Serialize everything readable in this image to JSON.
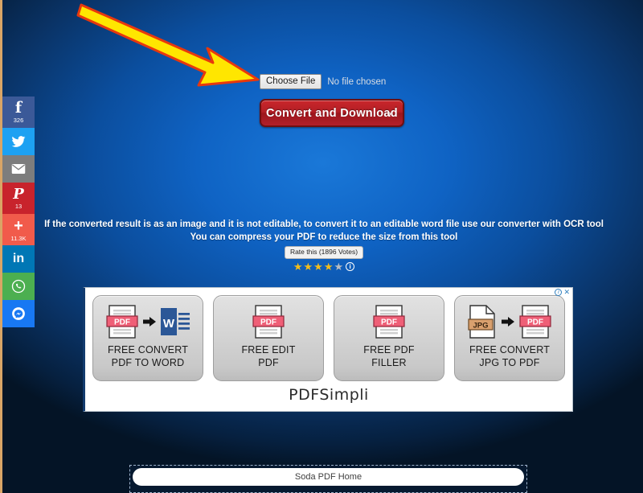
{
  "theme": {
    "background_center": "#0f63c4",
    "background_edge": "#041426",
    "accent_red": "#b41f25",
    "left_border": "#d9a566"
  },
  "social_bar": {
    "items": [
      {
        "name": "facebook",
        "glyph": "f",
        "count": "326",
        "color": "#3b5998"
      },
      {
        "name": "twitter",
        "glyph": "twitter-icon",
        "count": "",
        "color": "#1da1f2"
      },
      {
        "name": "email",
        "glyph": "envelope-icon",
        "count": "",
        "color": "#7d7d7d"
      },
      {
        "name": "pinterest",
        "glyph": "P",
        "count": "13",
        "color": "#c8232c"
      },
      {
        "name": "sharethis",
        "glyph": "+",
        "count": "11.3K",
        "color": "#f15b4b"
      },
      {
        "name": "linkedin",
        "glyph": "in",
        "count": "",
        "color": "#0077b5"
      },
      {
        "name": "whatsapp",
        "glyph": "whatsapp-icon",
        "count": "",
        "color": "#4caf50"
      },
      {
        "name": "messenger",
        "glyph": "messenger-icon",
        "count": "",
        "color": "#1878f3"
      }
    ]
  },
  "upload": {
    "choose_file_label": "Choose File",
    "no_file_text": "No file chosen",
    "convert_label": "Convert and Download",
    "convert_caret": "›"
  },
  "info": {
    "line1": "If the converted result is as an image and it is not editable, to convert it to an editable word file use our converter with OCR tool",
    "line2": "You can compress your PDF to reduce the size from this tool"
  },
  "rating": {
    "tooltip": "Rate this (1896 Votes)",
    "stars_filled": 4,
    "stars_total": 5,
    "star_glyph": "★",
    "info_glyph": "i"
  },
  "ad": {
    "adchoices_label": "ⓘ",
    "close_label": "✕",
    "brand": "PDFSimpli",
    "cards": [
      {
        "label_line1": "FREE CONVERT",
        "label_line2": "PDF TO WORD",
        "icon_from": "PDF",
        "icon_to": "WORD"
      },
      {
        "label_line1": "FREE EDIT",
        "label_line2": "PDF",
        "icon_from": "PDF",
        "icon_to": ""
      },
      {
        "label_line1": "FREE PDF",
        "label_line2": "FILLER",
        "icon_from": "PDF",
        "icon_to": ""
      },
      {
        "label_line1": "FREE CONVERT",
        "label_line2": "JPG TO PDF",
        "icon_from": "JPG",
        "icon_to": "PDF"
      }
    ]
  },
  "bottom_banner": {
    "label": "Soda PDF Home"
  }
}
